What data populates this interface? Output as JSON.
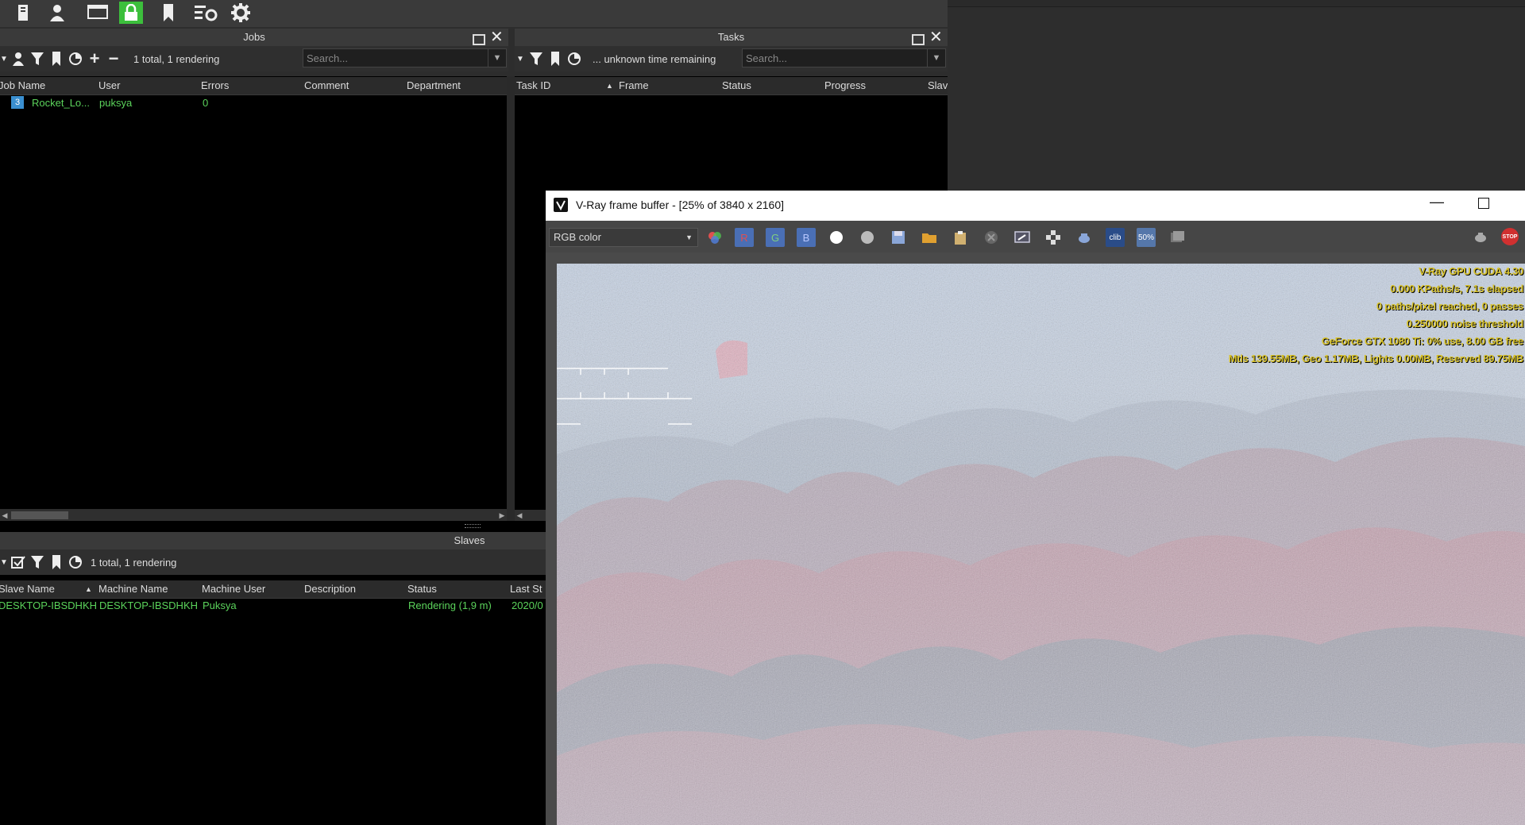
{
  "toolbar": {
    "icons": [
      "job-list-icon",
      "user-icon",
      "monitor-icon",
      "lock-icon",
      "bookmark-icon",
      "settings-list-icon",
      "gear-icon"
    ]
  },
  "jobs": {
    "title": "Jobs",
    "status": "1 total, 1 rendering",
    "search_placeholder": "Search...",
    "columns": [
      "Job Name",
      "User",
      "Errors",
      "Comment",
      "Department"
    ],
    "rows": [
      {
        "name": "Rocket_Lo...",
        "user": "puksya",
        "errors": "0"
      }
    ]
  },
  "tasks": {
    "title": "Tasks",
    "status": "... unknown time remaining",
    "search_placeholder": "Search...",
    "columns": [
      "Task ID",
      "Frame",
      "Status",
      "Progress",
      "Slav"
    ]
  },
  "slaves": {
    "title": "Slaves",
    "status": "1 total, 1 rendering",
    "columns": [
      "Slave Name",
      "Machine Name",
      "Machine User",
      "Description",
      "Status",
      "Last St"
    ],
    "rows": [
      {
        "slave": "DESKTOP-IBSDHKH",
        "machine": "DESKTOP-IBSDHKH",
        "user": "Puksya",
        "description": "",
        "status": "Rendering (1,9 m)",
        "last": "2020/0"
      }
    ]
  },
  "vfb": {
    "title": "V-Ray frame buffer - [25% of 3840 x 2160]",
    "channel": "RGB color",
    "channel_buttons": [
      "R",
      "G",
      "B"
    ],
    "zoom_label": "50%",
    "stop_label": "STOP",
    "info_lines": [
      "V-Ray GPU CUDA 4.30",
      "0.000 KPaths/s, 7.1s elapsed",
      "0 paths/pixel reached, 0 passes",
      "0.250000 noise threshold",
      "GeForce GTX 1080 Ti: 0% use, 8.00 GB free",
      "Mtls 139.55MB, Geo 1.17MB, Lights 0.00MB, Reserved 89.75MB"
    ],
    "colors": {
      "accent_blue": "#4a6fb5",
      "info_yellow": "#d8c22a",
      "status_green": "#5bd35b",
      "lock_green": "#3cbf3c"
    }
  }
}
